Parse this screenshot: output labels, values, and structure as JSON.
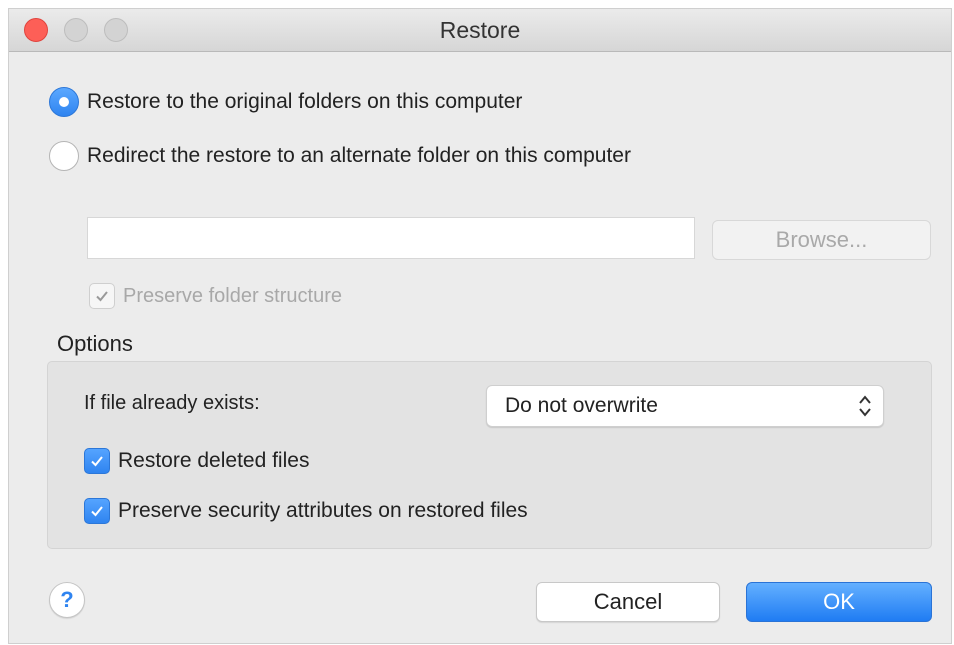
{
  "window": {
    "title": "Restore"
  },
  "restore_mode": {
    "original_label": "Restore to the original folders on this computer",
    "original_selected": true,
    "redirect_label": "Redirect the restore to an alternate folder on this computer",
    "redirect_selected": false
  },
  "alternate": {
    "path_value": "",
    "browse_label": "Browse...",
    "preserve_structure_label": "Preserve folder structure",
    "preserve_structure_checked": true
  },
  "options": {
    "heading": "Options",
    "if_exists_label": "If file already exists:",
    "if_exists_value": "Do not overwrite",
    "restore_deleted_label": "Restore deleted files",
    "restore_deleted_checked": true,
    "preserve_security_label": "Preserve security attributes on restored files",
    "preserve_security_checked": true
  },
  "footer": {
    "help_glyph": "?",
    "cancel_label": "Cancel",
    "ok_label": "OK"
  },
  "colors": {
    "accent": "#2f84f0",
    "close_light": "#fd5f57"
  }
}
